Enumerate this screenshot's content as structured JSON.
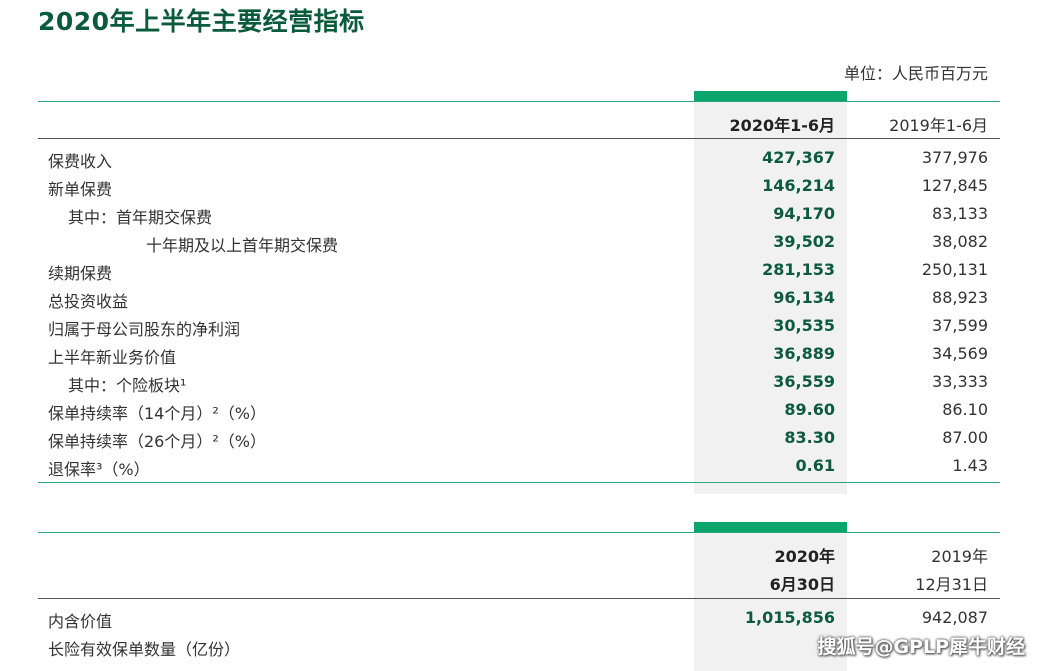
{
  "title": "2020年上半年主要经营指标",
  "unit_label": "单位：人民币百万元",
  "table1": {
    "col_current": "2020年1-6月",
    "col_previous": "2019年1-6月",
    "rows": [
      {
        "label": "保费收入",
        "current": "427,367",
        "previous": "377,976"
      },
      {
        "label": "新单保费",
        "current": "146,214",
        "previous": "127,845"
      },
      {
        "label": "其中：首年期交保费",
        "current": "94,170",
        "previous": "83,133"
      },
      {
        "label": "十年期及以上首年期交保费",
        "current": "39,502",
        "previous": "38,082"
      },
      {
        "label": "续期保费",
        "current": "281,153",
        "previous": "250,131"
      },
      {
        "label": "总投资收益",
        "current": "96,134",
        "previous": "88,923"
      },
      {
        "label": "归属于母公司股东的净利润",
        "current": "30,535",
        "previous": "37,599"
      },
      {
        "label": "上半年新业务价值",
        "current": "36,889",
        "previous": "34,569"
      },
      {
        "label": "其中：个险板块¹",
        "current": "36,559",
        "previous": "33,333"
      },
      {
        "label": "保单持续率（14个月）²（%）",
        "current": "89.60",
        "previous": "86.10"
      },
      {
        "label": "保单持续率（26个月）²（%）",
        "current": "83.30",
        "previous": "87.00"
      },
      {
        "label": "退保率³（%）",
        "current": "0.61",
        "previous": "1.43"
      }
    ]
  },
  "table2": {
    "col_current_line1": "2020年",
    "col_current_line2": "6月30日",
    "col_previous_line1": "2019年",
    "col_previous_line2": "12月31日",
    "rows": [
      {
        "label": "内含价值",
        "current": "1,015,856",
        "previous": "942,087"
      },
      {
        "label": "长险有效保单数量（亿份）",
        "current": "",
        "previous": ""
      }
    ]
  },
  "watermark": "搜狐号@GPLP犀牛财经"
}
